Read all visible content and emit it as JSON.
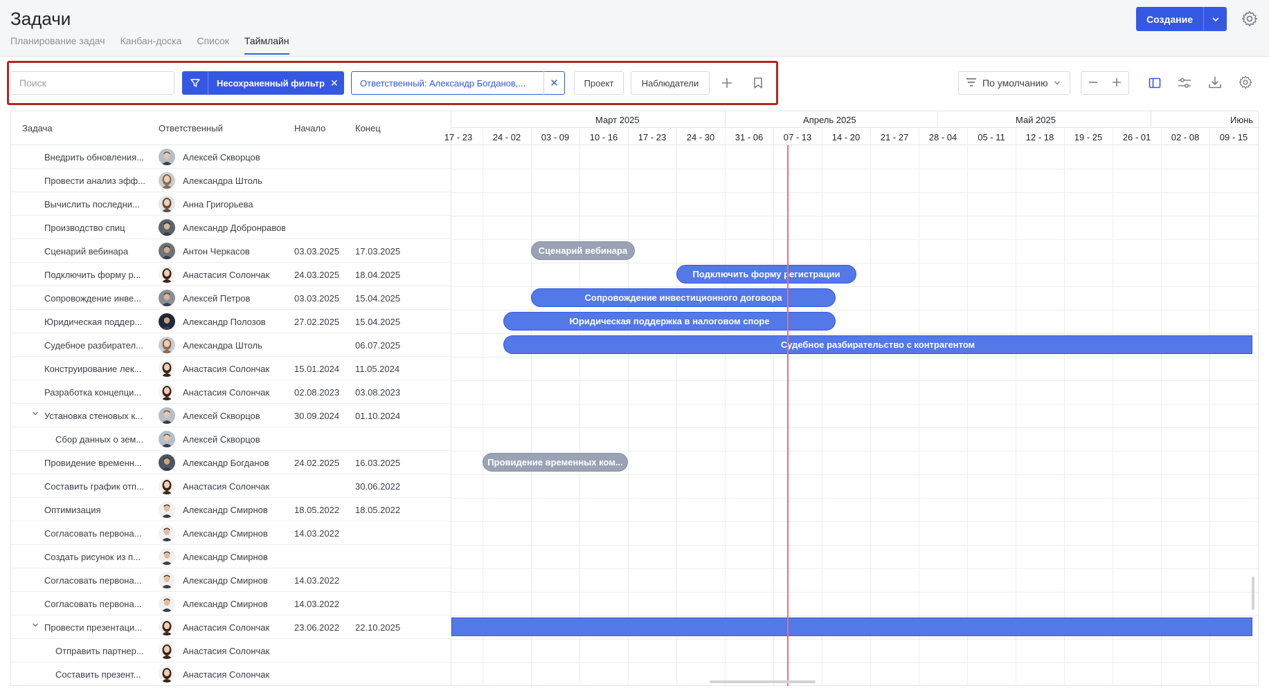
{
  "header": {
    "title": "Задачи",
    "tabs": [
      {
        "label": "Планирование задач"
      },
      {
        "label": "Канбан-доска"
      },
      {
        "label": "Список"
      },
      {
        "label": "Таймлайн"
      }
    ],
    "create_label": "Создание"
  },
  "filters": {
    "search_placeholder": "Поиск",
    "unsaved_label": "Несохраненный фильтр",
    "assignee_chip": "Ответственный: Александр Богданов,...",
    "project_label": "Проект",
    "watchers_label": "Наблюдатели",
    "sort_label": "По умолчанию"
  },
  "columns": {
    "task": "Задача",
    "assignee": "Ответственный",
    "start": "Начало",
    "end": "Конец"
  },
  "timeline": {
    "months": [
      "Март 2025",
      "Апрель 2025",
      "Май 2025",
      "Июнь"
    ],
    "weeks": [
      "17 - 23",
      "24 - 02",
      "03 - 09",
      "10 - 16",
      "17 - 23",
      "24 - 30",
      "31 - 06",
      "07 - 13",
      "14 - 20",
      "21 - 27",
      "28 - 04",
      "05 - 11",
      "12 - 18",
      "19 - 25",
      "26 - 01",
      "02 - 08",
      "09 - 15"
    ]
  },
  "rows": [
    {
      "task": "Внедрить обновления...",
      "assignee": "Алексей Скворцов",
      "start": "",
      "end": "",
      "avatar": "m1",
      "indent": 0
    },
    {
      "task": "Провести анализ эфф...",
      "assignee": "Александра Штоль",
      "start": "",
      "end": "",
      "avatar": "f2",
      "indent": 0
    },
    {
      "task": "Вычислить последни...",
      "assignee": "Анна Григорьева",
      "start": "",
      "end": "",
      "avatar": "f3",
      "indent": 0
    },
    {
      "task": "Производство спиц",
      "assignee": "Александр Добронравов",
      "start": "",
      "end": "",
      "avatar": "m2",
      "indent": 0
    },
    {
      "task": "Сценарий вебинара",
      "assignee": "Антон Черкасов",
      "start": "03.03.2025",
      "end": "17.03.2025",
      "avatar": "m3",
      "indent": 0
    },
    {
      "task": "Подключить форму р...",
      "assignee": "Анастасия Солончак",
      "start": "24.03.2025",
      "end": "18.04.2025",
      "avatar": "f1",
      "indent": 0
    },
    {
      "task": "Сопровождение инве...",
      "assignee": "Алексей Петров",
      "start": "03.03.2025",
      "end": "15.04.2025",
      "avatar": "m4",
      "indent": 0
    },
    {
      "task": "Юридическая поддер...",
      "assignee": "Александр Полозов",
      "start": "27.02.2025",
      "end": "15.04.2025",
      "avatar": "m5",
      "indent": 0
    },
    {
      "task": "Судебное разбирател...",
      "assignee": "Александра Штоль",
      "start": "",
      "end": "06.07.2025",
      "avatar": "f2",
      "indent": 0
    },
    {
      "task": "Конструирование лек...",
      "assignee": "Анастасия Солончак",
      "start": "15.01.2024",
      "end": "11.05.2024",
      "avatar": "f1",
      "indent": 0
    },
    {
      "task": "Разработка концепци...",
      "assignee": "Анастасия Солончак",
      "start": "02.08.2023",
      "end": "03.08.2023",
      "avatar": "f1",
      "indent": 0
    },
    {
      "task": "Установка стеновых к...",
      "assignee": "Алексей Скворцов",
      "start": "30.09.2024",
      "end": "01.10.2024",
      "avatar": "m1",
      "indent": 0,
      "expanded": true
    },
    {
      "task": "Сбор данных о зем...",
      "assignee": "Алексей Скворцов",
      "start": "",
      "end": "",
      "avatar": "m1",
      "indent": 1
    },
    {
      "task": "Провидение временн...",
      "assignee": "Александр Богданов",
      "start": "24.02.2025",
      "end": "16.03.2025",
      "avatar": "m6",
      "indent": 0
    },
    {
      "task": "Составить график отп...",
      "assignee": "Анастасия Солончак",
      "start": "",
      "end": "30.06.2022",
      "avatar": "f1",
      "indent": 0
    },
    {
      "task": "Оптимизация",
      "assignee": "Александр Смирнов",
      "start": "18.05.2022",
      "end": "18.05.2022",
      "avatar": "m7",
      "indent": 0
    },
    {
      "task": "Согласовать первона...",
      "assignee": "Александр Смирнов",
      "start": "14.03.2022",
      "end": "",
      "avatar": "m7",
      "indent": 0
    },
    {
      "task": "Создать рисунок из п...",
      "assignee": "Александр Смирнов",
      "start": "",
      "end": "",
      "avatar": "m7",
      "indent": 0
    },
    {
      "task": "Согласовать первона...",
      "assignee": "Александр Смирнов",
      "start": "14.03.2022",
      "end": "",
      "avatar": "m7",
      "indent": 0
    },
    {
      "task": "Согласовать первона...",
      "assignee": "Александр Смирнов",
      "start": "14.03.2022",
      "end": "",
      "avatar": "m7",
      "indent": 0
    },
    {
      "task": "Провести презентаци...",
      "assignee": "Анастасия Солончак",
      "start": "23.06.2022",
      "end": "22.10.2025",
      "avatar": "f1",
      "indent": 0,
      "expanded": true
    },
    {
      "task": "Отправить партнер...",
      "assignee": "Анастасия Солончак",
      "start": "",
      "end": "",
      "avatar": "f1",
      "indent": 1
    },
    {
      "task": "Составить презент...",
      "assignee": "Анастасия Солончак",
      "start": "",
      "end": "",
      "avatar": "f1",
      "indent": 1
    }
  ],
  "bars": [
    {
      "row": 4,
      "label": "Сценарий вебинара",
      "start": "03.03.2025",
      "end": "17.03.2025",
      "status": "gray"
    },
    {
      "row": 5,
      "label": "Подключить форму регистрации",
      "start": "24.03.2025",
      "end": "18.04.2025",
      "status": "blue"
    },
    {
      "row": 6,
      "label": "Сопровождение инвестиционного договора",
      "start": "03.03.2025",
      "end": "15.04.2025",
      "status": "blue"
    },
    {
      "row": 7,
      "label": "Юридическая поддержка в налоговом споре",
      "start": "27.02.2025",
      "end": "15.04.2025",
      "status": "blue"
    },
    {
      "row": 8,
      "label": "Судебное разбирательство с контрагентом",
      "start": "27.02.2025",
      "end": "06.07.2025",
      "status": "blue"
    },
    {
      "row": 13,
      "label": "Провидение временных ком...",
      "start": "24.02.2025",
      "end": "16.03.2025",
      "status": "gray"
    },
    {
      "row": 20,
      "label": "",
      "start": "23.06.2022",
      "end": "22.10.2025",
      "status": "blue"
    }
  ],
  "today": "2025-04-07",
  "colors": {
    "accent": "#3558e3",
    "bar_blue": "#5378e8",
    "bar_gray": "#9aa3b5",
    "today_line": "#ef6b7a",
    "highlight_frame": "#b3251f"
  }
}
